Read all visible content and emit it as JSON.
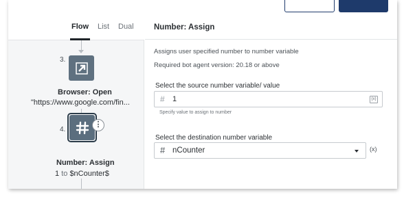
{
  "flow_view": {
    "tabs": [
      {
        "label": "Flow",
        "active": true
      },
      {
        "label": "List",
        "active": false
      },
      {
        "label": "Dual",
        "active": false
      }
    ],
    "steps": [
      {
        "number": "3.",
        "icon": "open-in-browser-icon",
        "title": "Browser: Open",
        "subtitle": "\"https://www.google.com/fin..."
      },
      {
        "number": "4.",
        "icon": "hash-icon",
        "title": "Number: Assign",
        "subtitle_value": "1",
        "subtitle_to": "to",
        "subtitle_var": "$nCounter$",
        "selected": true
      }
    ]
  },
  "properties": {
    "title": "Number: Assign",
    "description": "Assigns user specified number to number variable",
    "required_version": "Required bot agent version: 20.18 or above",
    "source_field": {
      "label": "Select the source number variable/ value",
      "value": "1",
      "hint": "Specify value to assign to number",
      "icon": "insert-variable-icon",
      "icon_text": "{x}"
    },
    "destination_field": {
      "label": "Select the destination number variable",
      "value": "nCounter",
      "var_button": "(x)"
    }
  },
  "colors": {
    "node": "#5f7180",
    "header_button": "#1e3a6b",
    "panel_bg": "#f5f6f7"
  }
}
